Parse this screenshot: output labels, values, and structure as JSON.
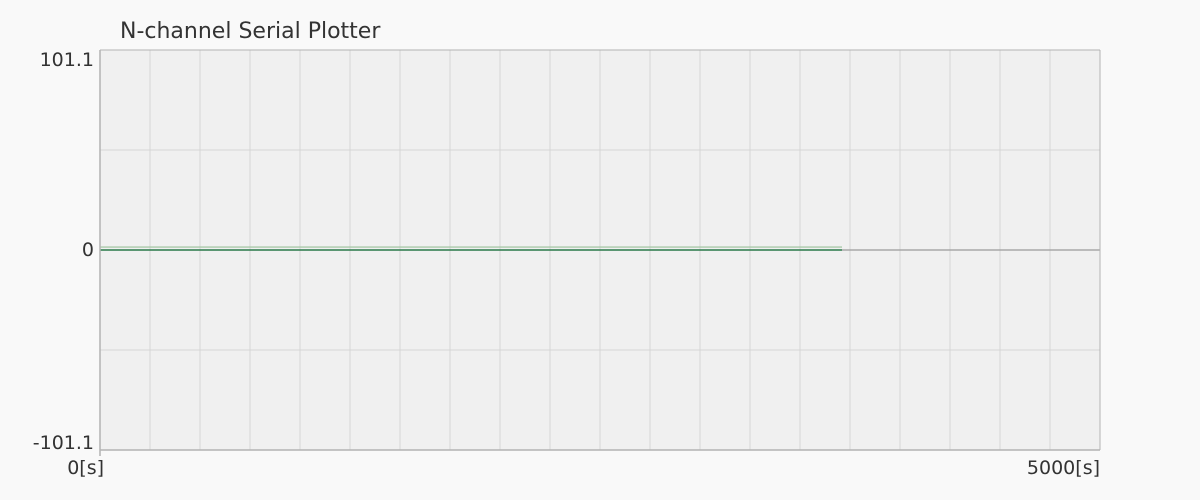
{
  "window": {
    "title": "N-channel Serial Plotter"
  },
  "colors": {
    "background": "#f9f9f9",
    "plot_area": "#f0f0f0",
    "grid": "#d6d6d6",
    "frame": "#b3b3b3",
    "zero_line": "#9a9a9a",
    "series": [
      "#a9c9a9",
      "#2f7f4f"
    ]
  },
  "chart_data": {
    "type": "line",
    "title": "N-channel Serial Plotter",
    "xlabel": "",
    "ylabel": "",
    "xlim": [
      0,
      5000
    ],
    "ylim": [
      -101.1,
      101.1
    ],
    "x_unit": "s",
    "x_tick_labels": [
      "0[s]",
      "5000[s]"
    ],
    "y_tick_labels": [
      "101.1",
      "0",
      "-101.1"
    ],
    "grid": true,
    "vertical_gridlines": 20,
    "horizontal_gridlines": 4,
    "legend": "none",
    "series": [
      {
        "x": [
          0,
          3710
        ],
        "y": [
          1.5,
          1.5
        ]
      },
      {
        "x": [
          0,
          3710
        ],
        "y": [
          0,
          0
        ]
      }
    ]
  }
}
